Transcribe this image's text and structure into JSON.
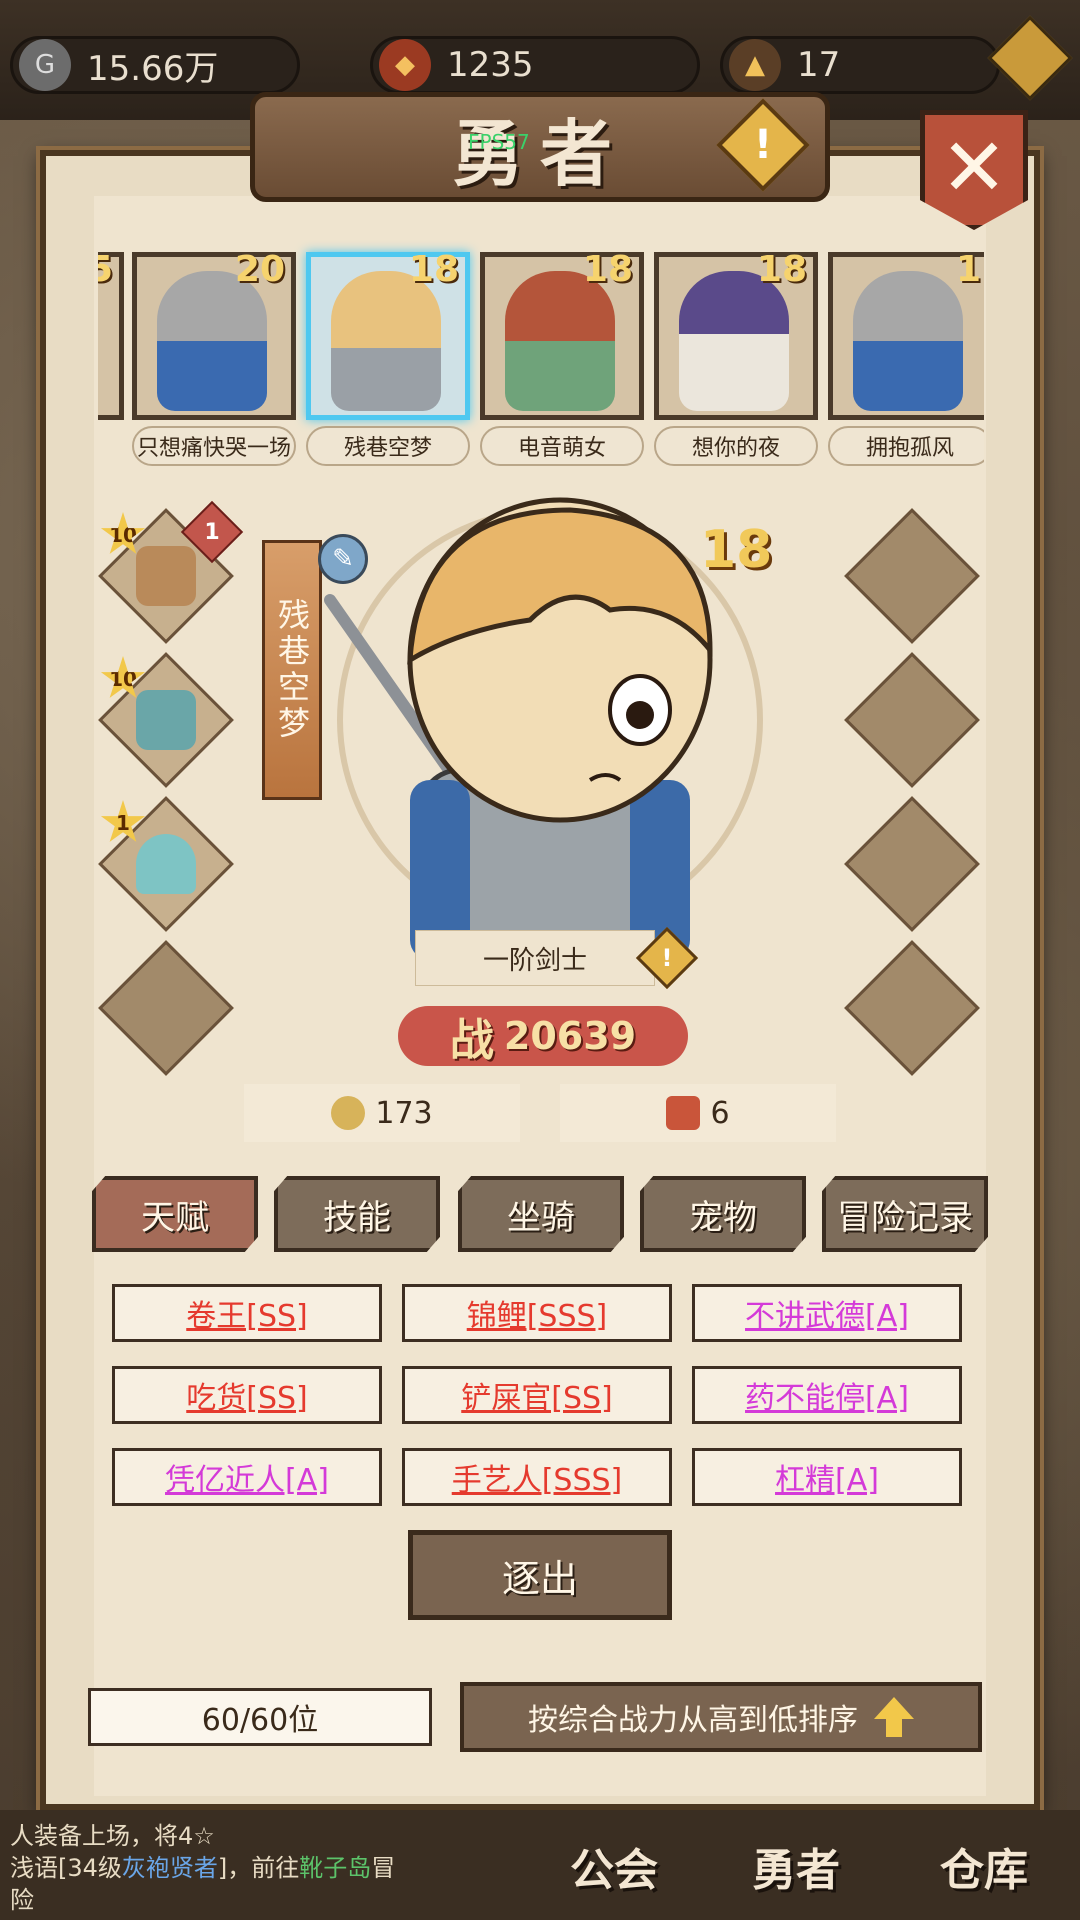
{
  "resources": {
    "gold": "15.66万",
    "gems": "1235",
    "tower": "17"
  },
  "panel": {
    "title": "勇者",
    "fps": "FPS57",
    "warn_icon": "!",
    "close_icon": "✕"
  },
  "roster": [
    {
      "name": "",
      "level": "5"
    },
    {
      "name": "只想痛快哭一场",
      "level": "20"
    },
    {
      "name": "残巷空梦",
      "level": "18"
    },
    {
      "name": "电音萌女",
      "level": "18"
    },
    {
      "name": "想你的夜",
      "level": "18"
    },
    {
      "name": "拥抱孤风",
      "level": "1"
    }
  ],
  "hero": {
    "name": "残巷空梦",
    "level": "18",
    "class": "一阶剑士",
    "power_label": "战",
    "power": "20639",
    "gold": "173",
    "stars": "6",
    "equipment": [
      {
        "stars": "10",
        "badge": "1"
      },
      {
        "stars": "10"
      },
      {
        "stars": "1"
      }
    ]
  },
  "tabs": [
    "天赋",
    "技能",
    "坐骑",
    "宠物",
    "冒险记录"
  ],
  "talents": [
    {
      "label": "卷王[SS]",
      "color": "red"
    },
    {
      "label": "锦鲤[SSS]",
      "color": "red"
    },
    {
      "label": "不讲武德[A]",
      "color": "pink"
    },
    {
      "label": "吃货[SS]",
      "color": "red"
    },
    {
      "label": "铲屎官[SS]",
      "color": "red"
    },
    {
      "label": "药不能停[A]",
      "color": "pink"
    },
    {
      "label": "凭亿近人[A]",
      "color": "pink"
    },
    {
      "label": "手艺人[SSS]",
      "color": "red"
    },
    {
      "label": "杠精[A]",
      "color": "pink"
    }
  ],
  "expel_button": "逐出",
  "capacity": "60/60位",
  "sort_button": "按综合战力从高到低排序",
  "chat": {
    "line1": "人装备上场，将4☆",
    "line2_prefix": "浅语[34级",
    "line2_name": "灰袍贤者",
    "line2_mid": "]，前往",
    "line2_place": "靴子岛",
    "line2_suffix": "冒",
    "line3": "险"
  },
  "nav": [
    "公会",
    "勇者",
    "仓库"
  ],
  "colors": {
    "talent_red": "#e53a2e",
    "talent_pink": "#d43ad8",
    "selected_border": "#4ec8f0"
  }
}
